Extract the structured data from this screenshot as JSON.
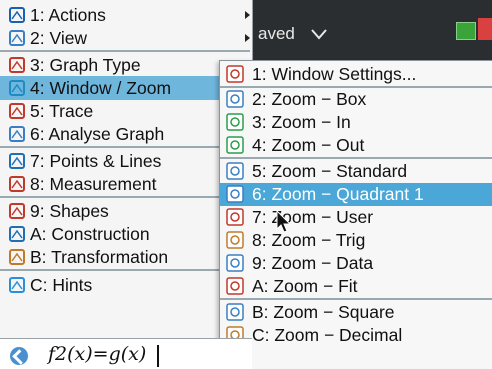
{
  "status": {
    "doc_label": "aved"
  },
  "left_menu": {
    "items": [
      {
        "label": "1: Actions",
        "icon": "arrow-icon",
        "submenu": true
      },
      {
        "label": "2: View",
        "icon": "view-icon",
        "submenu": true
      },
      {
        "label": "3: Graph Type",
        "icon": "graph-type-icon"
      },
      {
        "label": "4: Window / Zoom",
        "icon": "window-zoom-icon",
        "selected": true
      },
      {
        "label": "5: Trace",
        "icon": "trace-icon"
      },
      {
        "label": "6: Analyse Graph",
        "icon": "analyse-icon"
      },
      {
        "label": "7: Points & Lines",
        "icon": "points-icon"
      },
      {
        "label": "8: Measurement",
        "icon": "ruler-icon"
      },
      {
        "label": "9: Shapes",
        "icon": "shapes-icon"
      },
      {
        "label": "A: Construction",
        "icon": "construction-icon"
      },
      {
        "label": "B: Transformation",
        "icon": "transformation-icon"
      },
      {
        "label": "C: Hints",
        "icon": "hints-icon"
      }
    ]
  },
  "submenu": {
    "items": [
      {
        "label": "1: Window Settings...",
        "icon": "window-settings-icon"
      },
      {
        "label": "2: Zoom − Box",
        "icon": "zoom-box-icon"
      },
      {
        "label": "3: Zoom − In",
        "icon": "zoom-in-icon"
      },
      {
        "label": "4: Zoom − Out",
        "icon": "zoom-out-icon"
      },
      {
        "label": "5: Zoom − Standard",
        "icon": "zoom-standard-icon"
      },
      {
        "label": "6: Zoom − Quadrant 1",
        "icon": "zoom-quadrant-icon",
        "selected": true
      },
      {
        "label": "7: Zoom − User",
        "icon": "zoom-user-icon"
      },
      {
        "label": "8: Zoom − Trig",
        "icon": "zoom-trig-icon"
      },
      {
        "label": "9: Zoom − Data",
        "icon": "zoom-data-icon"
      },
      {
        "label": "A: Zoom − Fit",
        "icon": "zoom-fit-icon"
      },
      {
        "label": "B: Zoom − Square",
        "icon": "zoom-square-icon"
      },
      {
        "label": "C: Zoom − Decimal",
        "icon": "zoom-decimal-icon"
      }
    ]
  },
  "entry": {
    "formula": "f2(x)=g(x)"
  },
  "colors": {
    "selection": "#4aa7d8",
    "menu_bg": "#f5f5f5",
    "status_bar": "#2b2e30"
  }
}
